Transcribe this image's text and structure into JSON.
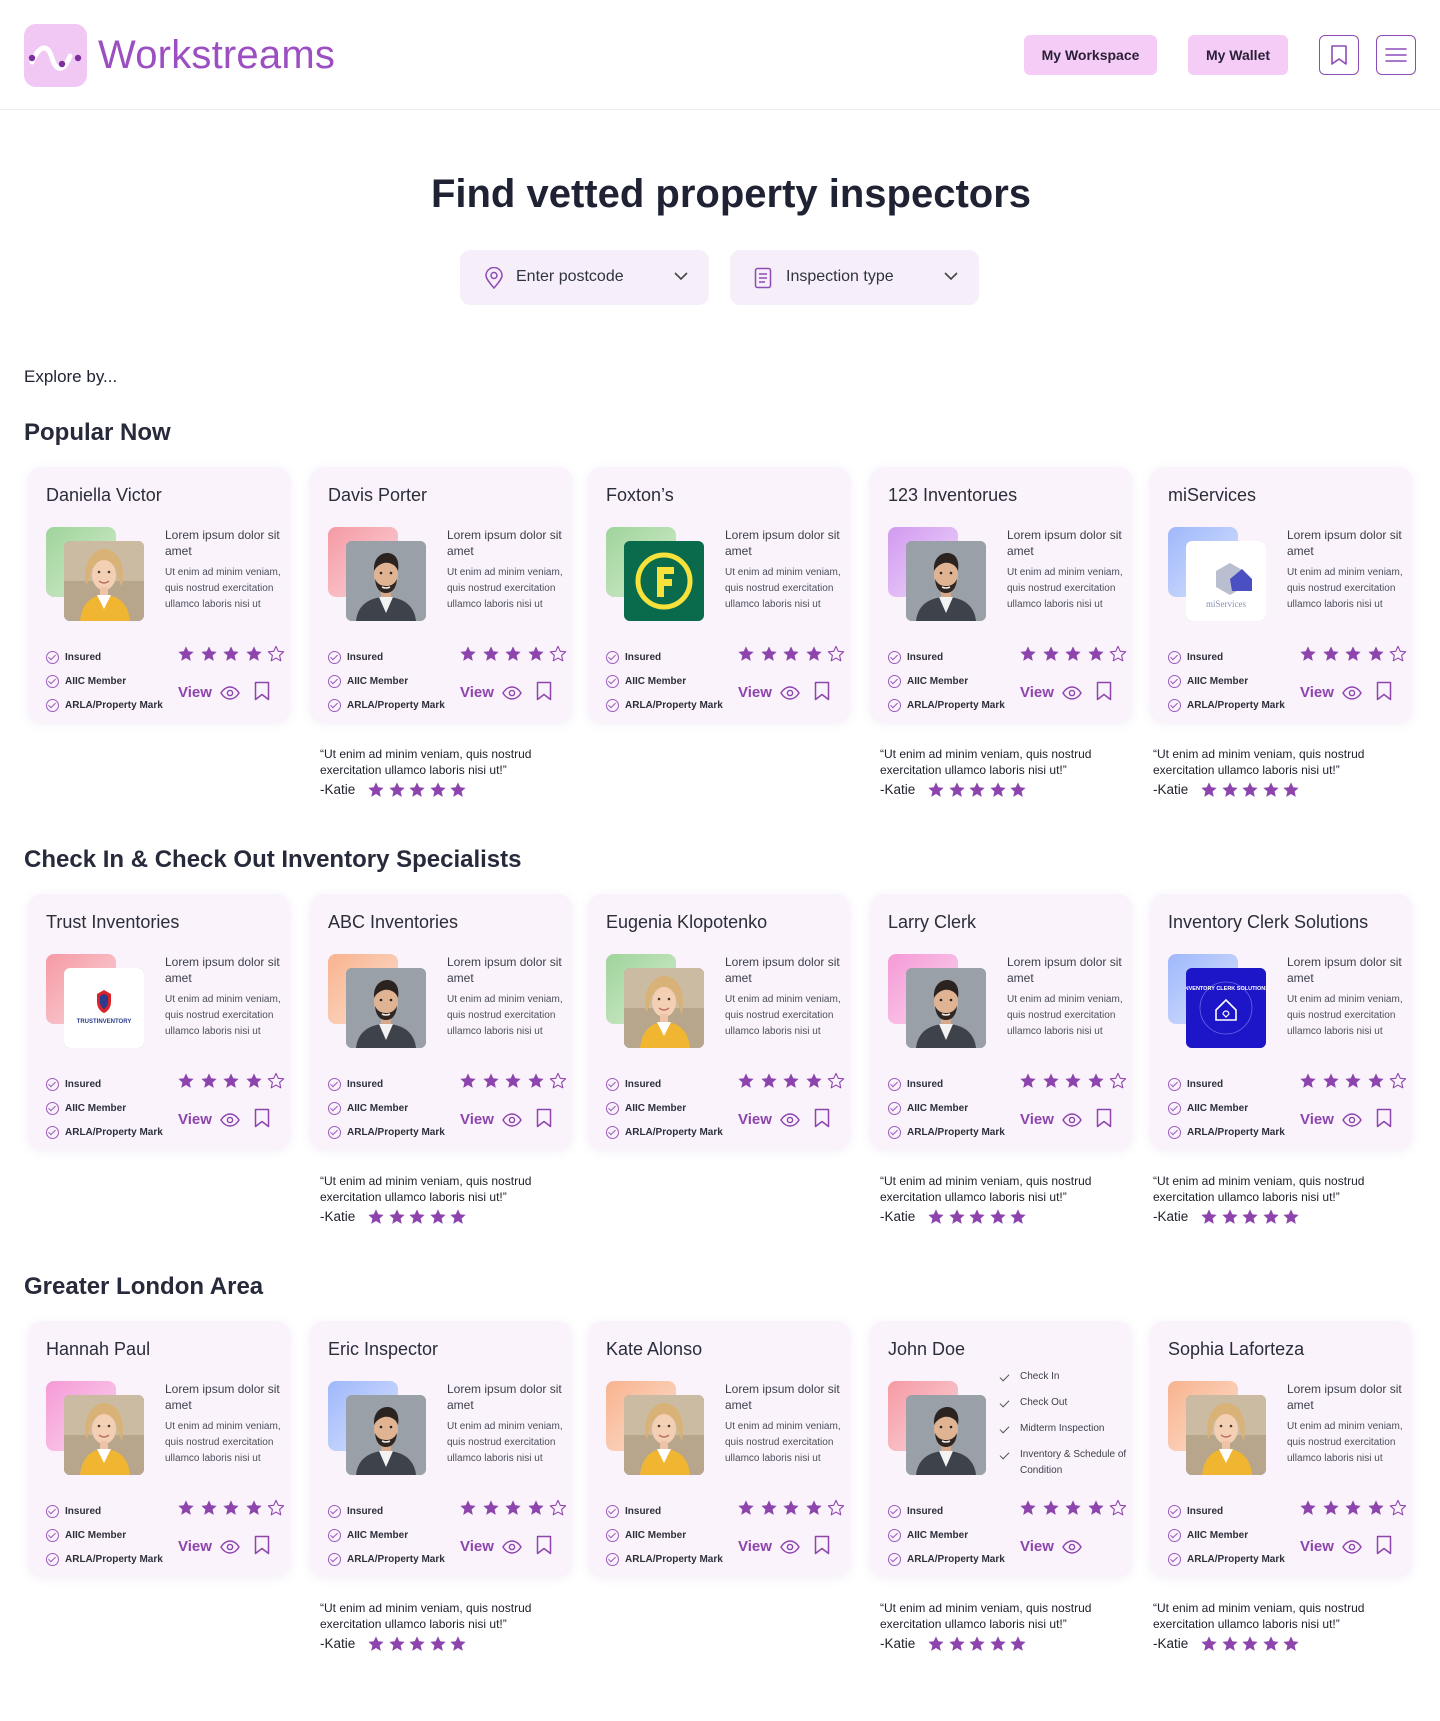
{
  "header": {
    "brand": "Workstreams",
    "workspace_label": "My Workspace",
    "wallet_label": "My Wallet",
    "icons": [
      "bookmark-icon",
      "menu-icon"
    ]
  },
  "hero": {
    "title": "Find vetted property inspectors",
    "postcode_label": "Enter postcode",
    "inspection_label": "Inspection type"
  },
  "explore_label": "Explore by...",
  "colors": {
    "accent": "#8e44ad",
    "brand": "#9b4fc2",
    "button_bg": "#f4ccf6",
    "card_bg": "#faf3fc"
  },
  "card_common": {
    "lorem_title": "Lorem ipsum dolor sit amet",
    "lorem_body": "Ut enim ad minim veniam, quis nostrud exercitation ullamco laboris nisi ut",
    "badges": [
      "Insured",
      "AIIC Member",
      "ARLA/Property Mark"
    ],
    "view_label": "View",
    "rating": 4,
    "rating_max": 5
  },
  "quote_common": {
    "text": "“Ut enim ad minim veniam, quis nostrud exercitation ullamco laboris nisi ut!”",
    "author": "-Katie",
    "rating": 5
  },
  "sections": [
    {
      "title": "Popular Now",
      "cards": [
        {
          "name": "Daniella Victor",
          "image": "woman-photo",
          "accent": "green"
        },
        {
          "name": "Davis Porter",
          "image": "man-photo",
          "accent": "red"
        },
        {
          "name": "Foxton’s",
          "image": "foxtons-logo",
          "accent": "green"
        },
        {
          "name": "123 Inventorues",
          "image": "man-photo",
          "accent": "purple"
        },
        {
          "name": "miServices",
          "image": "miservices-logo",
          "accent": "blue",
          "logo_text": "miServices"
        }
      ],
      "quotes_under": [
        1,
        3,
        4
      ]
    },
    {
      "title": "Check In & Check Out Inventory Specialists",
      "cards": [
        {
          "name": "Trust Inventories",
          "image": "trust-logo",
          "accent": "red",
          "logo_text": "TRUSTINVENTORY"
        },
        {
          "name": "ABC Inventories",
          "image": "man-photo",
          "accent": "orange"
        },
        {
          "name": "Eugenia Klopotenko",
          "image": "woman-photo",
          "accent": "green"
        },
        {
          "name": "Larry Clerk",
          "image": "man-photo",
          "accent": "pink"
        },
        {
          "name": "Inventory Clerk Solutions",
          "image": "clerk-logo",
          "accent": "blue",
          "logo_text": "INVENTORY CLERK SOLUTIONS"
        }
      ],
      "quotes_under": [
        1,
        3,
        4
      ]
    },
    {
      "title": "Greater London Area",
      "cards": [
        {
          "name": "Hannah Paul",
          "image": "woman-photo",
          "accent": "pink"
        },
        {
          "name": "Eric Inspector",
          "image": "man-photo",
          "accent": "blue"
        },
        {
          "name": "Kate Alonso",
          "image": "woman-photo",
          "accent": "orange"
        },
        {
          "name": "John Doe",
          "image": "man-photo",
          "accent": "red",
          "checklist": [
            "Check In",
            "Check Out",
            "Midterm Inspection",
            "Inventory & Schedule of Condition"
          ],
          "no_save": true
        },
        {
          "name": "Sophia Laforteza",
          "image": "woman-photo",
          "accent": "orange"
        }
      ],
      "quotes_under": [
        1,
        3,
        4
      ]
    }
  ]
}
